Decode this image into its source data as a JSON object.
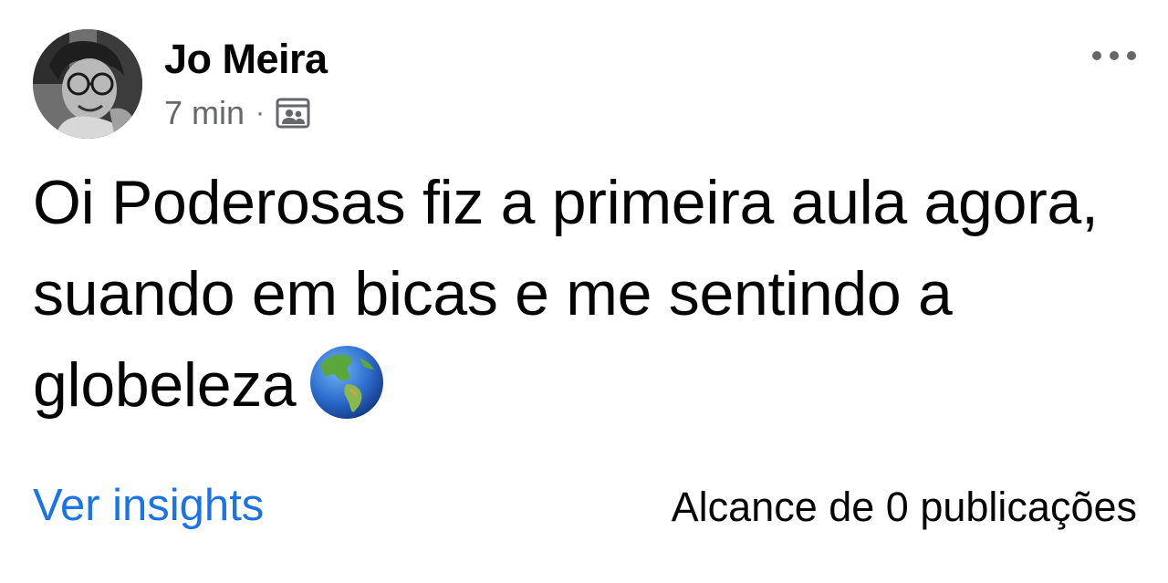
{
  "post": {
    "author": {
      "name": "Jo Meira",
      "avatar_icon": "profile-photo"
    },
    "meta": {
      "time": "7 min",
      "separator": "·",
      "audience_icon": "group-audience-icon"
    },
    "more_icon": "ellipsis-icon",
    "text": "Oi Poderosas fiz a primeira aula agora, suando em bicas e me sentindo a globeleza",
    "emoji_icon": "globe-americas-icon",
    "footer": {
      "insights_label": "Ver insights",
      "reach_label": "Alcance de 0 publicações"
    }
  },
  "colors": {
    "link": "#1b74e4",
    "secondary_text": "#65676b",
    "primary_text": "#050505",
    "background": "#ffffff"
  }
}
